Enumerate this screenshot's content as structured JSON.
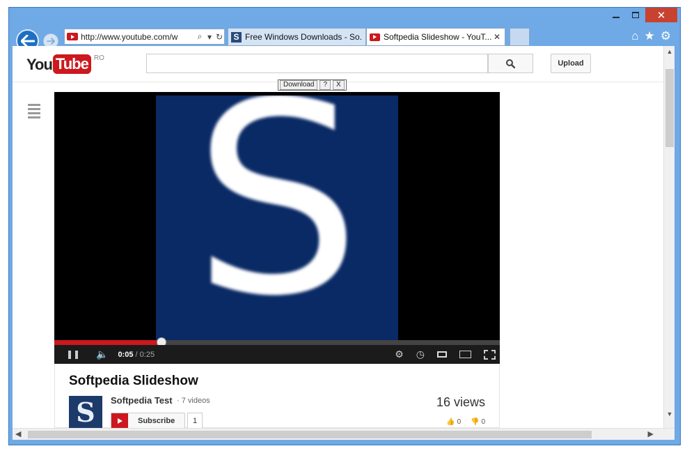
{
  "browser": {
    "address_url": "http://www.youtube.com/w",
    "tabs": [
      {
        "label": "Free Windows Downloads - So...",
        "favicon": "softpedia-s-icon",
        "active": false
      },
      {
        "label": "Softpedia Slideshow - YouT...",
        "favicon": "youtube-icon",
        "active": true
      }
    ],
    "caption": {
      "close": "✕"
    }
  },
  "youtube": {
    "logo_you": "You",
    "logo_tube": "Tube",
    "region": "RO",
    "search_placeholder": "",
    "upload_label": "Upload"
  },
  "download_helper": {
    "download_label": "Download",
    "help_label": "?",
    "close_label": "X"
  },
  "player": {
    "slide_letter": "S",
    "current_time": "0:05",
    "duration": "0:25",
    "progress_fraction": 0.24
  },
  "video": {
    "title": "Softpedia Slideshow",
    "channel_name": "Softpedia Test",
    "channel_videos": "· 7 videos",
    "avatar_letter": "S",
    "subscribe_label": "Subscribe",
    "subscriber_count": "1",
    "views": "16 views",
    "likes": "0",
    "dislikes": "0"
  },
  "colors": {
    "accent_red": "#cc181e",
    "window_frame": "#6fa9e6",
    "slide_bg": "#0a2a66"
  }
}
